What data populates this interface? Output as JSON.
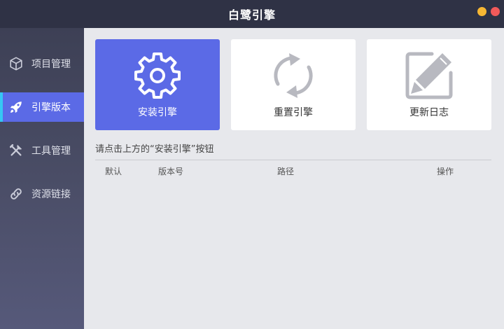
{
  "window": {
    "title": "白鹭引擎",
    "colors": {
      "titlebar": "#2f3245",
      "accent": "#5b6ae6",
      "active_indicator": "#36c6f4",
      "minimize": "#f7b733",
      "close": "#f25a5a"
    }
  },
  "sidebar": {
    "items": [
      {
        "label": "项目管理",
        "icon": "cube-icon",
        "active": false
      },
      {
        "label": "引擎版本",
        "icon": "rocket-icon",
        "active": true
      },
      {
        "label": "工具管理",
        "icon": "tools-icon",
        "active": false
      },
      {
        "label": "资源链接",
        "icon": "link-icon",
        "active": false
      }
    ]
  },
  "main": {
    "actions": [
      {
        "label": "安装引擎",
        "icon": "gear-icon"
      },
      {
        "label": "重置引擎",
        "icon": "refresh-icon"
      },
      {
        "label": "更新日志",
        "icon": "edit-log-icon"
      }
    ],
    "hint": "请点击上方的“安装引擎”按钮",
    "table": {
      "columns": [
        "默认",
        "版本号",
        "路径",
        "操作"
      ],
      "rows": []
    }
  }
}
